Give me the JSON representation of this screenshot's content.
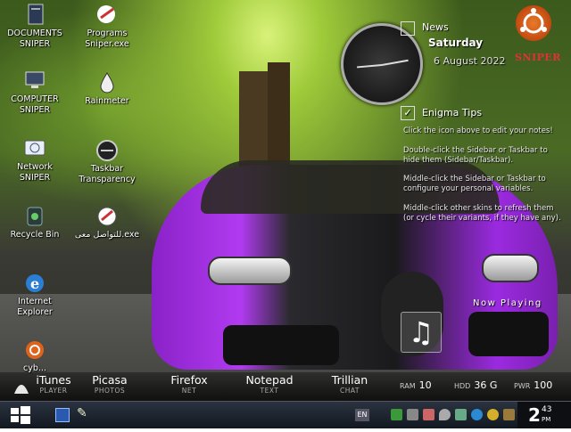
{
  "desktop": {
    "icons": [
      {
        "name": "DOCUMENTS SNIPER",
        "icon": "documents-icon"
      },
      {
        "name": "Programs Sniper.exe",
        "icon": "programs-icon"
      },
      {
        "name": "COMPUTER SNIPER",
        "icon": "computer-icon"
      },
      {
        "name": "Rainmeter",
        "icon": "rainmeter-icon"
      },
      {
        "name": "Network SNIPER",
        "icon": "network-icon"
      },
      {
        "name": "Taskbar Transparency",
        "icon": "taskbar-transparency-icon"
      },
      {
        "name": "Recycle Bin",
        "icon": "recycle-bin-icon"
      },
      {
        "name": "للتواصل معى.exe",
        "icon": "contact-exe-icon"
      },
      {
        "name": "Internet Explorer",
        "icon": "internet-explorer-icon"
      },
      {
        "name": "cyb...",
        "icon": "ubuntu-icon"
      }
    ]
  },
  "news": {
    "title": "News",
    "day": "Saturday",
    "date": "6 August 2022"
  },
  "tips": {
    "title": "Enigma Tips",
    "lines": [
      "Click the icon above to edit your notes!",
      "Double-click the Sidebar or Taskbar to",
      "hide them (Sidebar/Taskbar).",
      "Middle-click the Sidebar or Taskbar to",
      "configure your personal variables.",
      "Middle-click other skins to refresh them",
      "(or cycle their variants, if they have any)."
    ]
  },
  "logo": {
    "word": "SNIPER"
  },
  "now_playing": {
    "label": "Now Playing"
  },
  "dock": {
    "items": [
      {
        "name": "iTunes",
        "sub": "PLAYER"
      },
      {
        "name": "Picasa",
        "sub": "PHOTOS"
      },
      {
        "name": "Firefox",
        "sub": "NET"
      },
      {
        "name": "Notepad",
        "sub": "TEXT"
      },
      {
        "name": "Trillian",
        "sub": "CHAT"
      }
    ],
    "stats": [
      {
        "key": "RAM",
        "value": "10"
      },
      {
        "key": "HDD",
        "value": "36 G"
      },
      {
        "key": "PWR",
        "value": "100"
      }
    ]
  },
  "taskbar": {
    "lang": "EN",
    "time": "2",
    "minutes": "43",
    "ampm": "PM"
  },
  "colors": {
    "accent_purple": "#b13af0",
    "logo_orange": "#e87a2a",
    "logo_red": "#d33333"
  }
}
